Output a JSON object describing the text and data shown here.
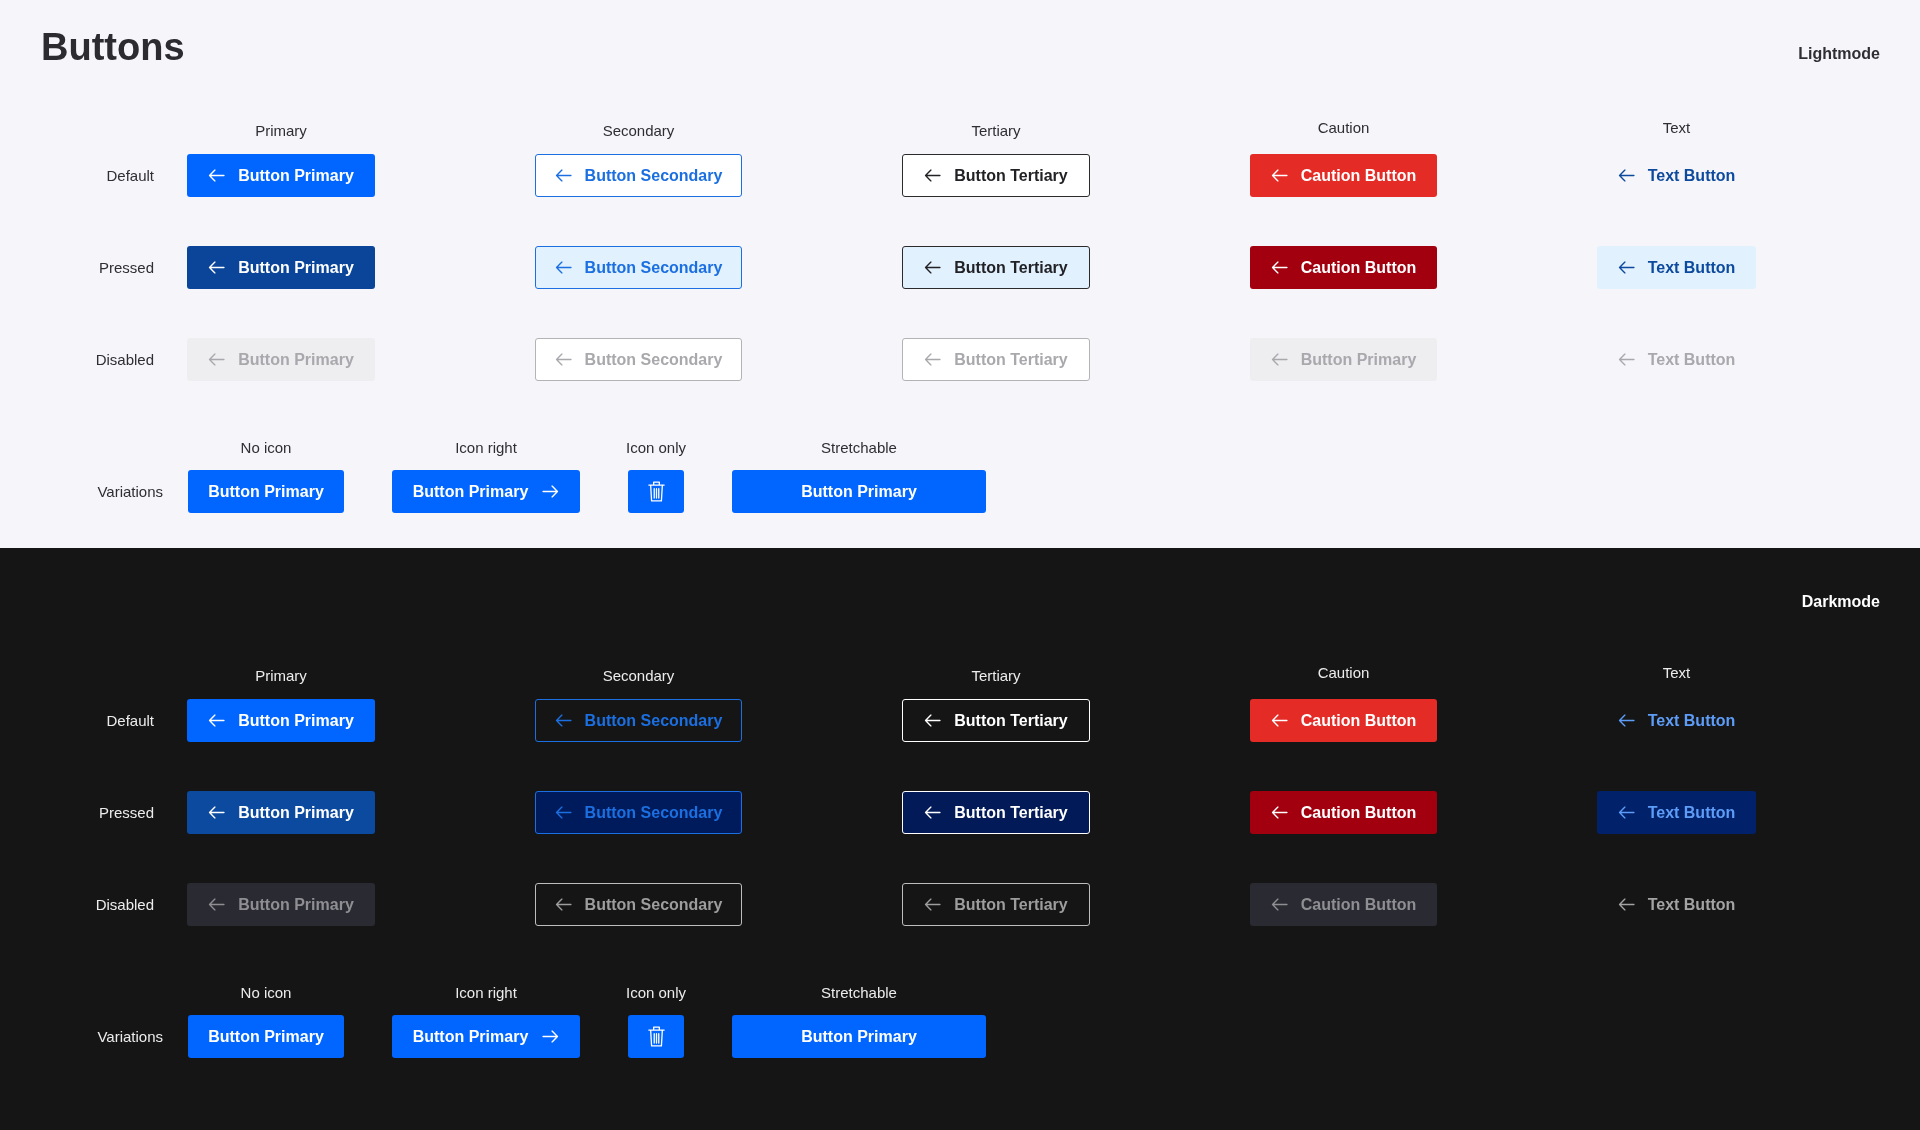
{
  "sections": [
    {
      "kind": "light",
      "title": "Buttons",
      "label": "Lightmode",
      "columns": [
        {
          "kind": "primary",
          "label": "Primary"
        },
        {
          "kind": "secondary",
          "label": "Secondary"
        },
        {
          "kind": "tertiary",
          "label": "Tertiary"
        },
        {
          "kind": "caution",
          "label": "Caution"
        },
        {
          "kind": "text",
          "label": "Text"
        }
      ],
      "rows": [
        {
          "label": "Default",
          "buttons": [
            {
              "text": "Button Primary",
              "pressed": false,
              "disabled": false
            },
            {
              "text": "Button Secondary",
              "pressed": false,
              "disabled": false
            },
            {
              "text": "Button Tertiary",
              "pressed": false,
              "disabled": false
            },
            {
              "text": "Caution Button",
              "pressed": false,
              "disabled": false
            },
            {
              "text": "Text Button",
              "pressed": false,
              "disabled": false
            }
          ]
        },
        {
          "label": "Pressed",
          "buttons": [
            {
              "text": "Button Primary",
              "pressed": true,
              "disabled": false
            },
            {
              "text": "Button Secondary",
              "pressed": true,
              "disabled": false
            },
            {
              "text": "Button Tertiary",
              "pressed": true,
              "disabled": false
            },
            {
              "text": "Caution Button",
              "pressed": true,
              "disabled": false
            },
            {
              "text": "Text Button",
              "pressed": true,
              "disabled": false
            }
          ]
        },
        {
          "label": "Disabled",
          "buttons": [
            {
              "text": "Button Primary",
              "pressed": false,
              "disabled": true
            },
            {
              "text": "Button Secondary",
              "pressed": false,
              "disabled": true
            },
            {
              "text": "Button Tertiary",
              "pressed": false,
              "disabled": true
            },
            {
              "text": "Button Primary",
              "pressed": false,
              "disabled": true
            },
            {
              "text": "Text Button",
              "pressed": false,
              "disabled": true
            }
          ]
        }
      ],
      "variations": {
        "label": "Variations",
        "items": [
          {
            "kind": "no_icon",
            "label": "No icon",
            "text": "Button Primary"
          },
          {
            "kind": "icon_right",
            "label": "Icon right",
            "text": "Button Primary"
          },
          {
            "kind": "icon_only",
            "label": "Icon only"
          },
          {
            "kind": "stretchable",
            "label": "Stretchable",
            "text": "Button Primary"
          }
        ]
      }
    },
    {
      "kind": "dark",
      "label": "Darkmode",
      "columns": [
        {
          "kind": "primary",
          "label": "Primary"
        },
        {
          "kind": "secondary",
          "label": "Secondary"
        },
        {
          "kind": "tertiary",
          "label": "Tertiary"
        },
        {
          "kind": "caution",
          "label": "Caution"
        },
        {
          "kind": "text",
          "label": "Text"
        }
      ],
      "rows": [
        {
          "label": "Default",
          "buttons": [
            {
              "text": "Button Primary",
              "pressed": false,
              "disabled": false
            },
            {
              "text": "Button Secondary",
              "pressed": false,
              "disabled": false
            },
            {
              "text": "Button Tertiary",
              "pressed": false,
              "disabled": false
            },
            {
              "text": "Caution Button",
              "pressed": false,
              "disabled": false
            },
            {
              "text": "Text Button",
              "pressed": false,
              "disabled": false
            }
          ]
        },
        {
          "label": "Pressed",
          "buttons": [
            {
              "text": "Button Primary",
              "pressed": true,
              "disabled": false
            },
            {
              "text": "Button Secondary",
              "pressed": true,
              "disabled": false
            },
            {
              "text": "Button Tertiary",
              "pressed": true,
              "disabled": false
            },
            {
              "text": "Caution Button",
              "pressed": true,
              "disabled": false
            },
            {
              "text": "Text Button",
              "pressed": true,
              "disabled": false
            }
          ]
        },
        {
          "label": "Disabled",
          "buttons": [
            {
              "text": "Button Primary",
              "pressed": false,
              "disabled": true
            },
            {
              "text": "Button Secondary",
              "pressed": false,
              "disabled": true
            },
            {
              "text": "Button Tertiary",
              "pressed": false,
              "disabled": true
            },
            {
              "text": "Caution Button",
              "pressed": false,
              "disabled": true
            },
            {
              "text": "Text Button",
              "pressed": false,
              "disabled": true
            }
          ]
        }
      ],
      "variations": {
        "label": "Variations",
        "items": [
          {
            "kind": "no_icon",
            "label": "No icon",
            "text": "Button Primary"
          },
          {
            "kind": "icon_right",
            "label": "Icon right",
            "text": "Button Primary"
          },
          {
            "kind": "icon_only",
            "label": "Icon only"
          },
          {
            "kind": "stretchable",
            "label": "Stretchable",
            "text": "Button Primary"
          }
        ]
      }
    }
  ]
}
